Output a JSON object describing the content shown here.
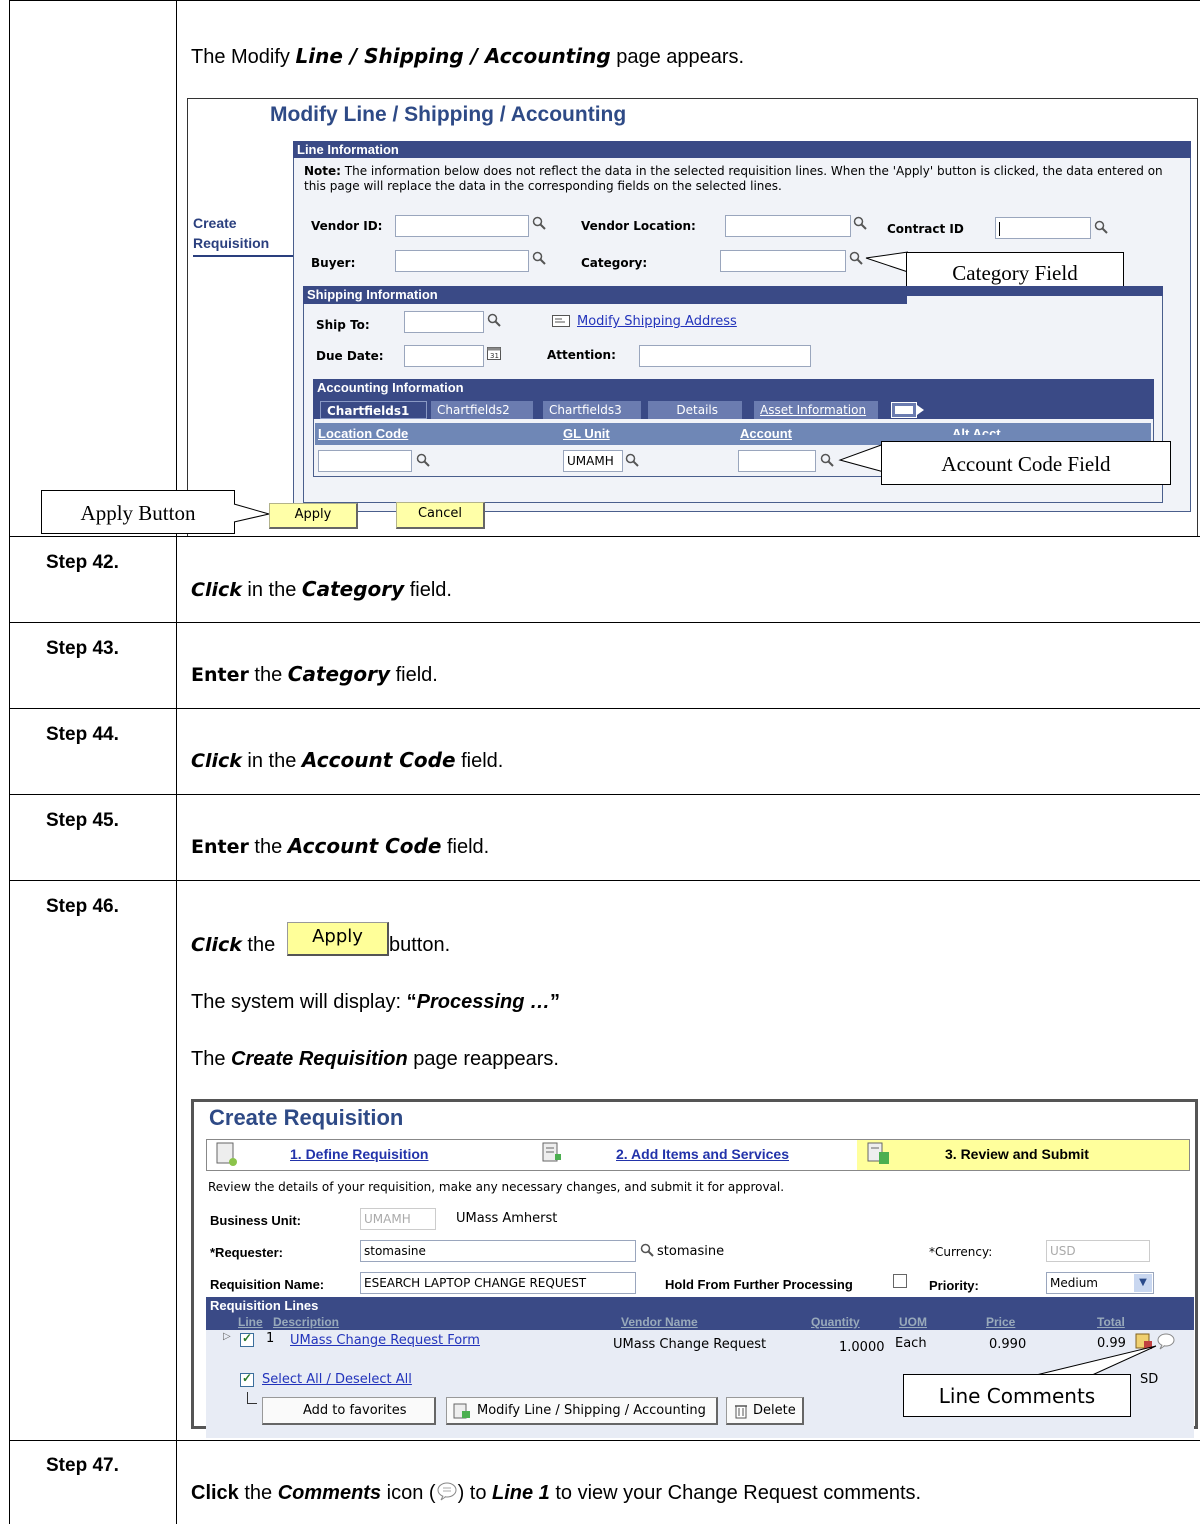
{
  "intro": {
    "prefix": "The Modify ",
    "emph": "Line / Shipping / Accounting",
    "suffix": " page appears."
  },
  "modify_screen": {
    "title": "Modify Line / Shipping / Accounting",
    "side_link": "Create Requisition",
    "line_info": {
      "header": "Line Information",
      "note_label": "Note:",
      "note_text": "The information below does not reflect the data in the selected requisition lines. When the 'Apply' button is clicked, the data entered on this page will replace the data in the corresponding fields on the selected lines.",
      "vendor_id": "Vendor ID:",
      "vendor_location": "Vendor Location:",
      "contract_id": "Contract ID",
      "buyer": "Buyer:",
      "category": "Category:"
    },
    "shipping": {
      "header": "Shipping Information",
      "ship_to": "Ship To:",
      "modify_address": "Modify Shipping Address",
      "due_date": "Due Date:",
      "attention": "Attention:"
    },
    "accounting": {
      "header": "Accounting Information",
      "tabs": [
        "Chartfields1",
        "Chartfields2",
        "Chartfields3",
        "Details",
        "Asset Information"
      ],
      "columns": [
        "Location Code",
        "GL Unit",
        "Account",
        "Alt Acct"
      ],
      "gl_unit_value": "UMAMH"
    },
    "buttons": {
      "apply": "Apply",
      "cancel": "Cancel"
    },
    "callouts": {
      "category": "Category Field",
      "account": "Account Code Field",
      "apply": "Apply Button"
    }
  },
  "steps": [
    {
      "num": "Step 42.",
      "verb": "Click",
      "pre": " in the ",
      "emph": "Category",
      "post": " field."
    },
    {
      "num": "Step 43.",
      "verb": "Enter",
      "pre": " the ",
      "emph": "Category",
      "post": " field."
    },
    {
      "num": "Step 44.",
      "verb": "Click",
      "pre": " in the ",
      "emph": "Account Code",
      "post": " field."
    },
    {
      "num": "Step 45.",
      "verb": "Enter",
      "pre": " the ",
      "emph": "Account Code",
      "post": " field."
    },
    {
      "num": "Step 46.",
      "verb": "Click",
      "pre": " the ",
      "btn": "Apply",
      "post": " button."
    },
    {
      "num": "Step 47.",
      "verb": "Click",
      "pre": " the ",
      "emph": "Comments",
      "mid": " icon (",
      "mid2": ") to ",
      "emph2": "Line 1",
      "post": " to view your Change Request comments."
    }
  ],
  "step46": {
    "processing_pre": "The system will display: ",
    "processing_quote_open": "“",
    "processing": "Processing …",
    "processing_quote_close": "”",
    "reappears_pre": "The ",
    "reappears_emph": "Create Requisition",
    "reappears_post": " page reappears."
  },
  "create_screen": {
    "title": "Create Requisition",
    "steps": [
      "1. Define Requisition",
      "2. Add Items and Services",
      "3. Review and Submit"
    ],
    "instructions": "Review the details of your requisition, make any necessary changes, and submit it for approval.",
    "business_unit_label": "Business Unit:",
    "business_unit_value": "UMAMH",
    "business_unit_name": "UMass Amherst",
    "requester_label": "*Requester:",
    "requester_value": "stomasine",
    "requester_name": "stomasine",
    "currency_label": "*Currency:",
    "currency_value": "USD",
    "req_name_label": "Requisition Name:",
    "req_name_value": "ESEARCH LAPTOP CHANGE REQUEST",
    "hold_label": "Hold From Further Processing",
    "priority_label": "Priority:",
    "priority_value": "Medium",
    "lines_header": "Requisition Lines",
    "columns": [
      "Line",
      "Description",
      "Vendor Name",
      "Quantity",
      "UOM",
      "Price",
      "Total"
    ],
    "row": {
      "line": "1",
      "description": "UMass Change Request Form",
      "vendor": "UMass Change Request",
      "quantity": "1.0000",
      "uom": "Each",
      "price": "0.990",
      "total": "0.99"
    },
    "select_all": "Select All / Deselect All",
    "partial_text": "SD",
    "buttons": [
      "Add to favorites",
      "Modify Line / Shipping / Accounting",
      "Delete"
    ],
    "callout": "Line Comments"
  }
}
